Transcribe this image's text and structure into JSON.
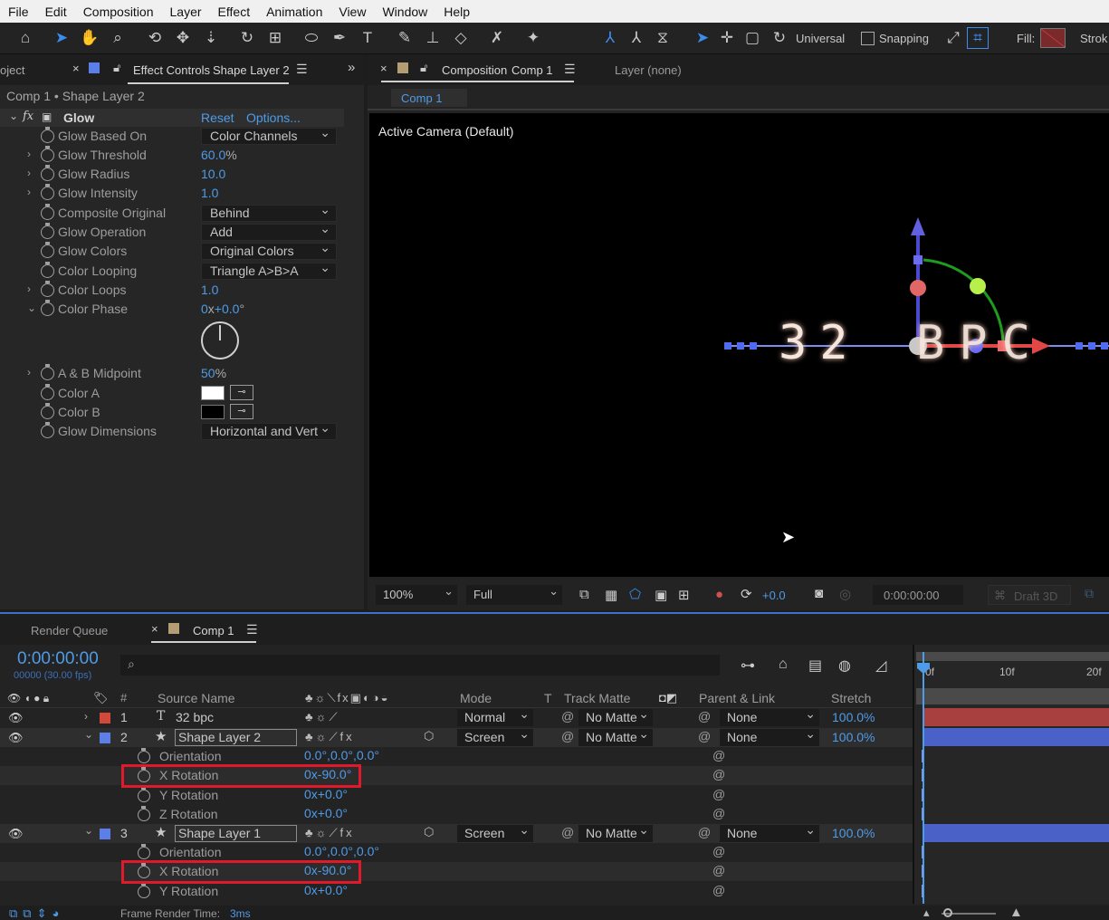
{
  "menu": [
    "File",
    "Edit",
    "Composition",
    "Layer",
    "Effect",
    "Animation",
    "View",
    "Window",
    "Help"
  ],
  "toolbar": {
    "universal_label": "Universal",
    "snapping_label": "Snapping",
    "fill_label": "Fill:",
    "stroke_label": "Strok"
  },
  "effect_panel": {
    "project_tab": "oject",
    "tab_title": "Effect Controls",
    "tab_layer": "Shape Layer 2",
    "header": "Comp 1 • Shape Layer 2",
    "effect_name": "Glow",
    "reset_label": "Reset",
    "options_label": "Options...",
    "props": [
      {
        "label": "Glow Based On",
        "kind": "dropdown",
        "value": "Color Channels"
      },
      {
        "label": "Glow Threshold",
        "kind": "value",
        "value": "60.0",
        "unit": "%"
      },
      {
        "label": "Glow Radius",
        "kind": "value",
        "value": "10.0"
      },
      {
        "label": "Glow Intensity",
        "kind": "value",
        "value": "1.0"
      },
      {
        "label": "Composite Original",
        "kind": "dropdown",
        "value": "Behind"
      },
      {
        "label": "Glow Operation",
        "kind": "dropdown",
        "value": "Add"
      },
      {
        "label": "Glow Colors",
        "kind": "dropdown",
        "value": "Original Colors"
      },
      {
        "label": "Color Looping",
        "kind": "dropdown",
        "value": "Triangle A>B>A"
      },
      {
        "label": "Color Loops",
        "kind": "value",
        "value": "1.0"
      },
      {
        "label": "Color Phase",
        "kind": "value",
        "value": "0",
        "value2": "+0.0",
        "unit": "°"
      },
      {
        "label": "A & B Midpoint",
        "kind": "value",
        "value": "50",
        "unit": "%"
      },
      {
        "label": "Color A",
        "kind": "swatch",
        "color": "#ffffff"
      },
      {
        "label": "Color B",
        "kind": "swatch",
        "color": "#000000"
      },
      {
        "label": "Glow Dimensions",
        "kind": "dropdown",
        "value": "Horizontal and Vert"
      }
    ]
  },
  "comp_panel": {
    "tab_title": "Composition",
    "tab_comp": "Comp 1",
    "layer_tab": "Layer (none)",
    "comp_subtab": "Comp 1",
    "camera_label": "Active Camera (Default)",
    "viewer_text_left": "32",
    "viewer_text_right": "BPC",
    "zoom": "100%",
    "resolution": "Full",
    "exposure": "+0.0",
    "timecode": "0:00:00:00",
    "renderer": "Draft 3D"
  },
  "timeline": {
    "render_queue_tab": "Render Queue",
    "comp_tab": "Comp 1",
    "timecode": "0:00:00:00",
    "frames_fps": "00000 (30.00 fps)",
    "search_placeholder": "",
    "columns": {
      "hash": "#",
      "source_name": "Source Name",
      "mode": "Mode",
      "t": "T",
      "track_matte": "Track Matte",
      "parent": "Parent & Link",
      "stretch": "Stretch"
    },
    "ruler": [
      "0f",
      "10f",
      "20f"
    ],
    "layers": [
      {
        "num": "1",
        "name": "32 bpc",
        "mode": "Normal",
        "matte": "No Matte",
        "parent": "None",
        "stretch": "100.0%",
        "color": "#d2483a"
      },
      {
        "num": "2",
        "name": "Shape Layer 2",
        "mode": "Screen",
        "matte": "No Matte",
        "parent": "None",
        "stretch": "100.0%",
        "color": "#5c7ee8"
      },
      {
        "num": "3",
        "name": "Shape Layer 1",
        "mode": "Screen",
        "matte": "No Matte",
        "parent": "None",
        "stretch": "100.0%",
        "color": "#5c7ee8"
      }
    ],
    "l2_props": [
      {
        "name": "Orientation",
        "value": "0.0°,0.0°,0.0°"
      },
      {
        "name": "X Rotation",
        "value": "0x-90.0°"
      },
      {
        "name": "Y Rotation",
        "value": "0x+0.0°"
      },
      {
        "name": "Z Rotation",
        "value": "0x+0.0°"
      }
    ],
    "l3_props": [
      {
        "name": "Orientation",
        "value": "0.0°,0.0°,0.0°"
      },
      {
        "name": "X Rotation",
        "value": "0x-90.0°"
      },
      {
        "name": "Y Rotation",
        "value": "0x+0.0°"
      }
    ],
    "frame_render_label": "Frame Render Time:",
    "frame_render_value": "3ms"
  },
  "colors": {
    "accent_blue": "#4e9be8",
    "highlight_red": "#e0192b"
  }
}
